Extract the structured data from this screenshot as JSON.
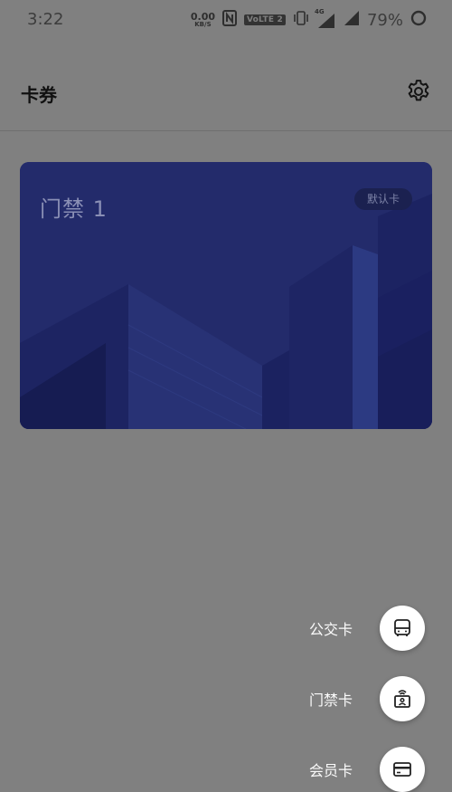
{
  "status_bar": {
    "time": "3:22",
    "net_speed_value": "0.00",
    "net_speed_unit": "KB/S",
    "nfc_icon": "nfc-icon",
    "volte_label": "VoLTE 2",
    "vibrate_icon": "vibrate-icon",
    "signal_label": "4G",
    "battery_percent": "79%"
  },
  "header": {
    "title": "卡券",
    "settings_icon": "gear-icon"
  },
  "card": {
    "title": "门禁 1",
    "badge": "默认卡",
    "colors": {
      "background": "#222a6a",
      "badge_bg": "#1b2150"
    }
  },
  "fab_menu": {
    "items": [
      {
        "label": "公交卡",
        "icon": "bus-icon"
      },
      {
        "label": "门禁卡",
        "icon": "access-card-icon"
      },
      {
        "label": "会员卡",
        "icon": "credit-card-icon"
      }
    ]
  },
  "colors": {
    "overlay": "#808080",
    "fab_bg": "#ffffff"
  }
}
